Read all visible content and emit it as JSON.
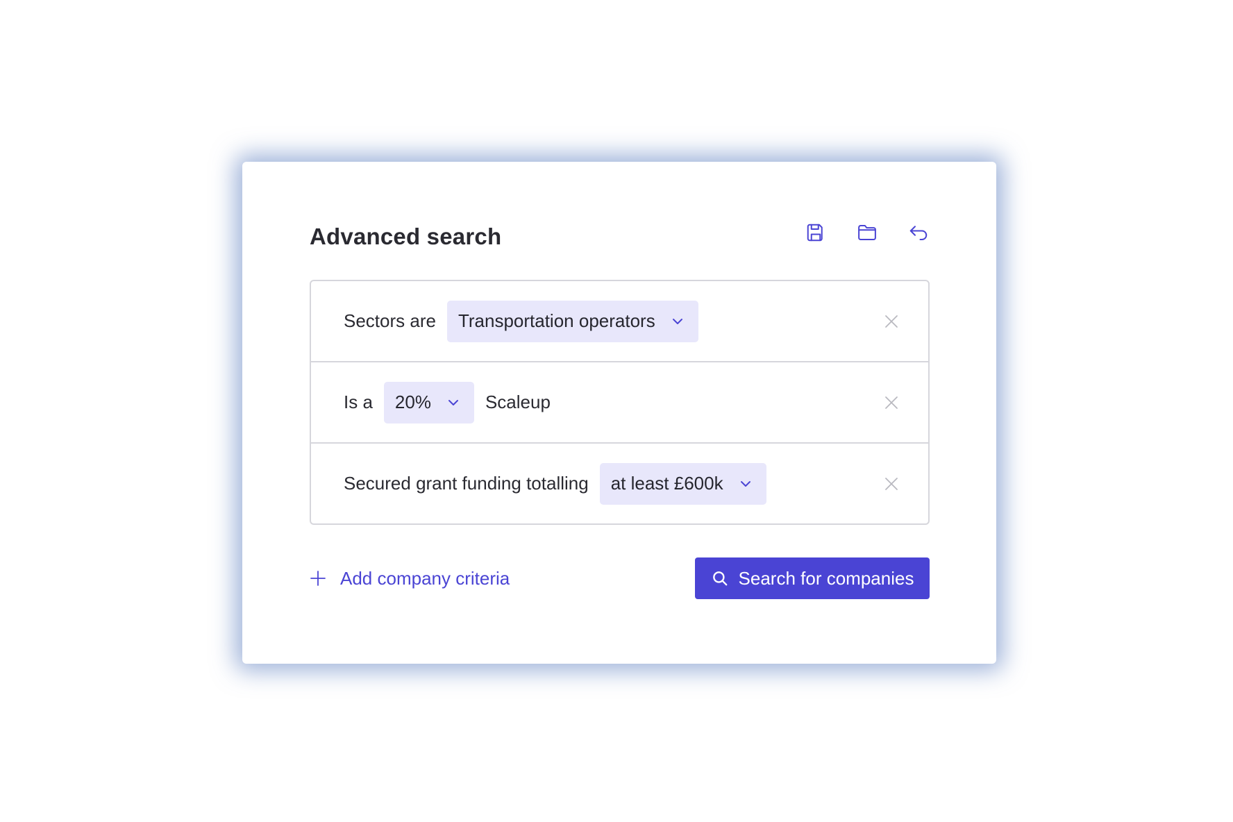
{
  "panel": {
    "title": "Advanced search",
    "toolbar": {
      "save_icon": "save-icon",
      "open_icon": "folder-icon",
      "undo_icon": "return-arrow-icon"
    }
  },
  "criteria": [
    {
      "prefix": "Sectors are",
      "dropdown_value": "Transportation operators",
      "suffix": ""
    },
    {
      "prefix": "Is a",
      "dropdown_value": "20%",
      "suffix": "Scaleup"
    },
    {
      "prefix": "Secured grant funding totalling",
      "dropdown_value": "at least £600k",
      "suffix": ""
    }
  ],
  "footer": {
    "add_label": "Add company criteria",
    "search_label": "Search for companies"
  },
  "colors": {
    "accent": "#4a44d4",
    "chip_background": "#e8e7fb",
    "border": "#d6d6dc",
    "glow": "#4e73b9"
  }
}
